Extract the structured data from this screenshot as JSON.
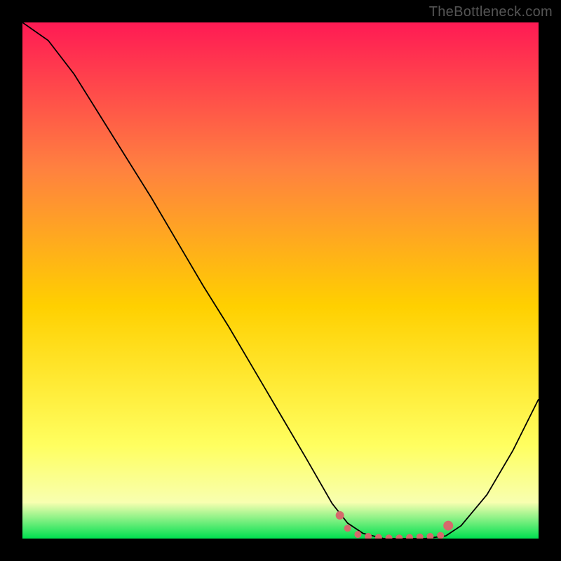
{
  "watermark": "TheBottleneck.com",
  "colors": {
    "background": "#000000",
    "gradient_top": "#ff1a54",
    "gradient_upper_mid": "#ff8040",
    "gradient_mid": "#ffd000",
    "gradient_lower_mid": "#ffff60",
    "gradient_low": "#f8ffb0",
    "gradient_bottom": "#00e050",
    "curve": "#000000",
    "marker": "#d56a6c"
  },
  "chart_data": {
    "type": "line",
    "title": "",
    "xlabel": "",
    "ylabel": "",
    "xlim": [
      0,
      1
    ],
    "ylim": [
      0,
      1
    ],
    "series": [
      {
        "name": "bottleneck-curve",
        "x": [
          0.0,
          0.05,
          0.1,
          0.15,
          0.2,
          0.25,
          0.3,
          0.35,
          0.4,
          0.45,
          0.5,
          0.55,
          0.6,
          0.63,
          0.66,
          0.7,
          0.74,
          0.78,
          0.82,
          0.85,
          0.9,
          0.95,
          1.0
        ],
        "y": [
          1.0,
          0.965,
          0.9,
          0.82,
          0.74,
          0.66,
          0.575,
          0.49,
          0.41,
          0.325,
          0.24,
          0.155,
          0.068,
          0.03,
          0.01,
          0.0,
          0.0,
          0.0,
          0.005,
          0.025,
          0.085,
          0.17,
          0.27
        ]
      }
    ],
    "markers": {
      "name": "optimal-range",
      "x": [
        0.615,
        0.63,
        0.65,
        0.67,
        0.69,
        0.71,
        0.73,
        0.75,
        0.77,
        0.79,
        0.81,
        0.825
      ],
      "y": [
        0.045,
        0.02,
        0.008,
        0.004,
        0.002,
        0.001,
        0.001,
        0.002,
        0.003,
        0.004,
        0.006,
        0.025
      ],
      "size": [
        6,
        5,
        5,
        5,
        5,
        5,
        5,
        5,
        5,
        5,
        5,
        7
      ]
    }
  }
}
